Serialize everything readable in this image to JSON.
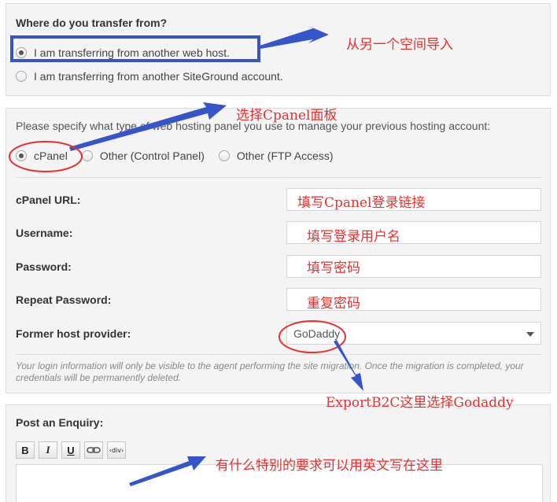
{
  "source": {
    "title": "Where do you transfer from?",
    "options": [
      {
        "label": "I am transferring from another web host.",
        "checked": true
      },
      {
        "label": "I am transferring from another SiteGround account.",
        "checked": false
      }
    ]
  },
  "details": {
    "hint": "Please specify what type of web hosting panel you use to manage your previous hosting account:",
    "panel_options": [
      {
        "label": "cPanel",
        "checked": true
      },
      {
        "label": "Other (Control Panel)",
        "checked": false
      },
      {
        "label": "Other (FTP Access)",
        "checked": false
      }
    ],
    "fields": {
      "cpanel_url": {
        "label": "cPanel URL:",
        "value": ""
      },
      "username": {
        "label": "Username:",
        "value": ""
      },
      "password": {
        "label": "Password:",
        "value": ""
      },
      "repeat_password": {
        "label": "Repeat Password:",
        "value": ""
      },
      "former_host": {
        "label": "Former host provider:",
        "value": "GoDaddy"
      }
    },
    "disclaimer": "Your login information will only be visible to the agent performing the site migration. Once the migration is completed, your credentials will be permanently deleted."
  },
  "enquiry": {
    "title": "Post an Enquiry:",
    "toolbar": [
      {
        "label": "B",
        "icon": "bold-icon"
      },
      {
        "label": "I",
        "icon": "italic-icon"
      },
      {
        "label": "U",
        "icon": "underline-icon"
      },
      {
        "label": "",
        "icon": "link-icon"
      },
      {
        "label": "‹div›",
        "icon": "div-icon"
      }
    ],
    "text": ""
  },
  "annotations": {
    "import_from_other": "从另一个空间导入",
    "choose_cpanel": "选择Cpanel面板",
    "fill_cpanel_url": "填写Cpanel登录链接",
    "fill_username": "填写登录用户名",
    "fill_password": "填写密码",
    "repeat_password": "重复密码",
    "choose_godaddy": "ExportB2C这里选择Godaddy",
    "special_requests": "有什么特别的要求可以用英文写在这里"
  },
  "colors": {
    "annotation_red": "#e83030",
    "arrow_blue": "#3555c8",
    "panel_bg": "#f4f4f4"
  }
}
